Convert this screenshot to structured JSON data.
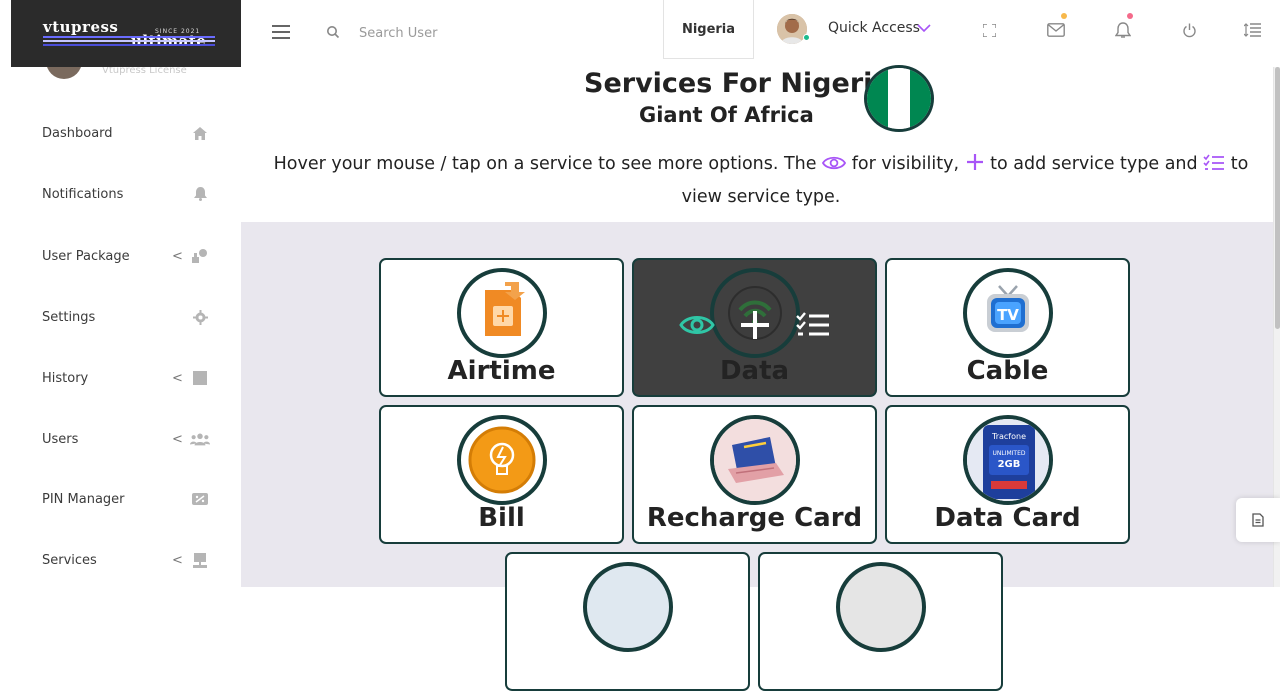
{
  "logo": {
    "brand_line1": "vtupress",
    "brand_line2": "ultimate",
    "since": "SINCE 2021",
    "stripe_colors": [
      "#6a6cff",
      "#c6c6ff",
      "#ffffff",
      "#4b4dd8"
    ]
  },
  "sidebar": {
    "license": "Vtupress License",
    "items": [
      {
        "label": "Dashboard",
        "icon": "home-icon",
        "has_chevron": false
      },
      {
        "label": "Notifications",
        "icon": "bell-icon",
        "has_chevron": false
      },
      {
        "label": "User Package",
        "icon": "package-icon",
        "has_chevron": true
      },
      {
        "label": "Settings",
        "icon": "gear-icon",
        "has_chevron": false
      },
      {
        "label": "History",
        "icon": "history-icon",
        "has_chevron": true
      },
      {
        "label": "Users",
        "icon": "users-icon",
        "has_chevron": true
      },
      {
        "label": "PIN Manager",
        "icon": "pin-icon",
        "has_chevron": false
      },
      {
        "label": "Services",
        "icon": "services-icon",
        "has_chevron": true
      }
    ],
    "chevron": "<"
  },
  "header": {
    "search_placeholder": "Search User",
    "country": "Nigeria",
    "quick_access": "Quick Access"
  },
  "main": {
    "title": "Services For Nigeria",
    "subtitle": "Giant Of Africa",
    "instr_part1": "Hover your mouse / tap on a service to see more options. The",
    "instr_part2": "for visibility,",
    "instr_part3": "to add service type and",
    "instr_part4": "to view service type.",
    "services": [
      {
        "name": "Airtime",
        "icon": "airtime-sim-icon"
      },
      {
        "name": "Data",
        "icon": "data-wifi-icon",
        "hovered": true
      },
      {
        "name": "Cable",
        "icon": "cable-tv-icon"
      },
      {
        "name": "Bill",
        "icon": "bill-bulb-icon"
      },
      {
        "name": "Recharge Card",
        "icon": "recharge-card-icon"
      },
      {
        "name": "Data Card",
        "icon": "data-card-icon"
      }
    ]
  },
  "colors": {
    "accent": "#a855f7",
    "card_border": "#173d3b",
    "eye_green": "#2fc6a6",
    "nigeria_green": "#008751",
    "grid_bg": "#e9e7ee"
  }
}
